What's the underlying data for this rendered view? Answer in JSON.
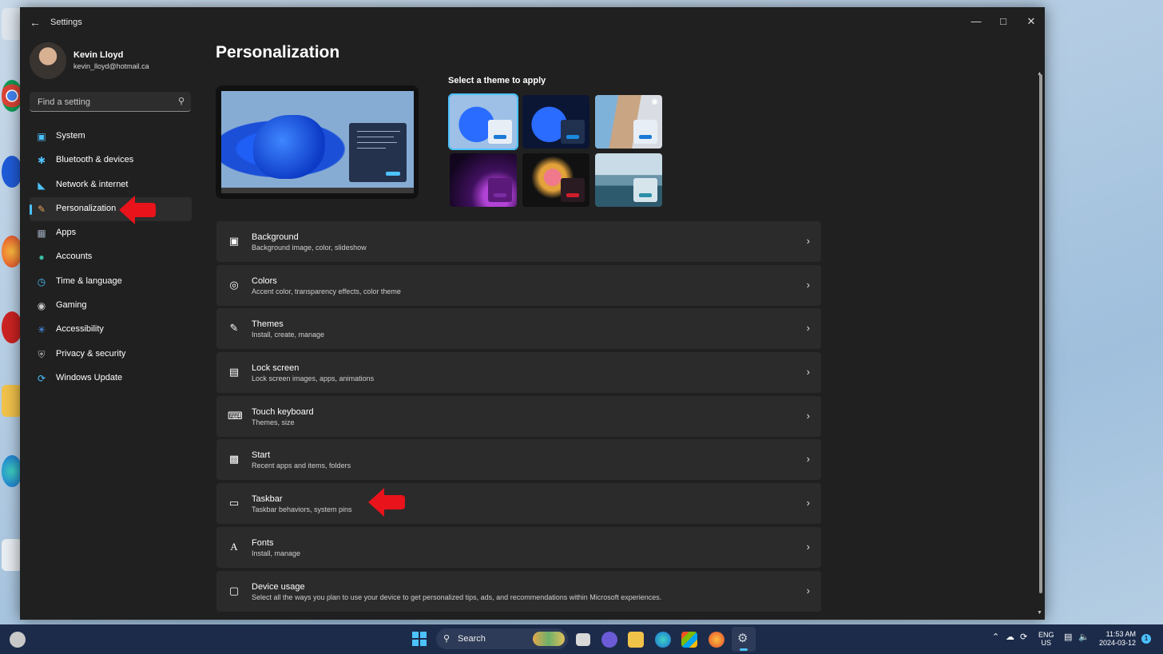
{
  "window": {
    "app_title": "Settings"
  },
  "profile": {
    "name": "Kevin Lloyd",
    "email": "kevin_lloyd@hotmail.ca"
  },
  "search": {
    "placeholder": "Find a setting",
    "icon": "search-icon"
  },
  "nav": {
    "items": [
      {
        "label": "System",
        "icon": "monitor-icon",
        "color": "#4cc2ff"
      },
      {
        "label": "Bluetooth & devices",
        "icon": "bluetooth-icon",
        "color": "#4cc2ff"
      },
      {
        "label": "Network & internet",
        "icon": "wifi-icon",
        "color": "#4cc2ff"
      },
      {
        "label": "Personalization",
        "icon": "brush-icon",
        "color": "#e8a05a",
        "active": true
      },
      {
        "label": "Apps",
        "icon": "apps-icon",
        "color": "#9aa7b8"
      },
      {
        "label": "Accounts",
        "icon": "person-icon",
        "color": "#38c0a3"
      },
      {
        "label": "Time & language",
        "icon": "clock-globe-icon",
        "color": "#4cc2ff"
      },
      {
        "label": "Gaming",
        "icon": "gamepad-icon",
        "color": "#c8c8c8"
      },
      {
        "label": "Accessibility",
        "icon": "accessibility-icon",
        "color": "#4c9bff"
      },
      {
        "label": "Privacy & security",
        "icon": "shield-icon",
        "color": "#b0b0b0"
      },
      {
        "label": "Windows Update",
        "icon": "update-icon",
        "color": "#4cc2ff"
      }
    ]
  },
  "main": {
    "title": "Personalization",
    "theme_label": "Select a theme to apply",
    "cards": [
      {
        "title": "Background",
        "subtitle": "Background image, color, slideshow",
        "icon": "image-icon"
      },
      {
        "title": "Colors",
        "subtitle": "Accent color, transparency effects, color theme",
        "icon": "palette-icon"
      },
      {
        "title": "Themes",
        "subtitle": "Install, create, manage",
        "icon": "pen-brush-icon"
      },
      {
        "title": "Lock screen",
        "subtitle": "Lock screen images, apps, animations",
        "icon": "lock-screen-icon"
      },
      {
        "title": "Touch keyboard",
        "subtitle": "Themes, size",
        "icon": "keyboard-icon"
      },
      {
        "title": "Start",
        "subtitle": "Recent apps and items, folders",
        "icon": "start-icon"
      },
      {
        "title": "Taskbar",
        "subtitle": "Taskbar behaviors, system pins",
        "icon": "taskbar-icon"
      },
      {
        "title": "Fonts",
        "subtitle": "Install, manage",
        "icon": "fonts-icon"
      },
      {
        "title": "Device usage",
        "subtitle": "Select all the ways you plan to use your device to get personalized tips, ads, and recommendations within Microsoft experiences.",
        "icon": "device-usage-icon"
      }
    ]
  },
  "taskbar": {
    "search_label": "Search",
    "lang_line1": "ENG",
    "lang_line2": "US",
    "time": "11:53 AM",
    "date": "2024-03-12",
    "notification_count": "1"
  },
  "colors": {
    "accent": "#4cc2ff",
    "annotation_arrow": "#e8131b",
    "window_bg": "#202020",
    "card_bg": "#2b2b2b"
  }
}
